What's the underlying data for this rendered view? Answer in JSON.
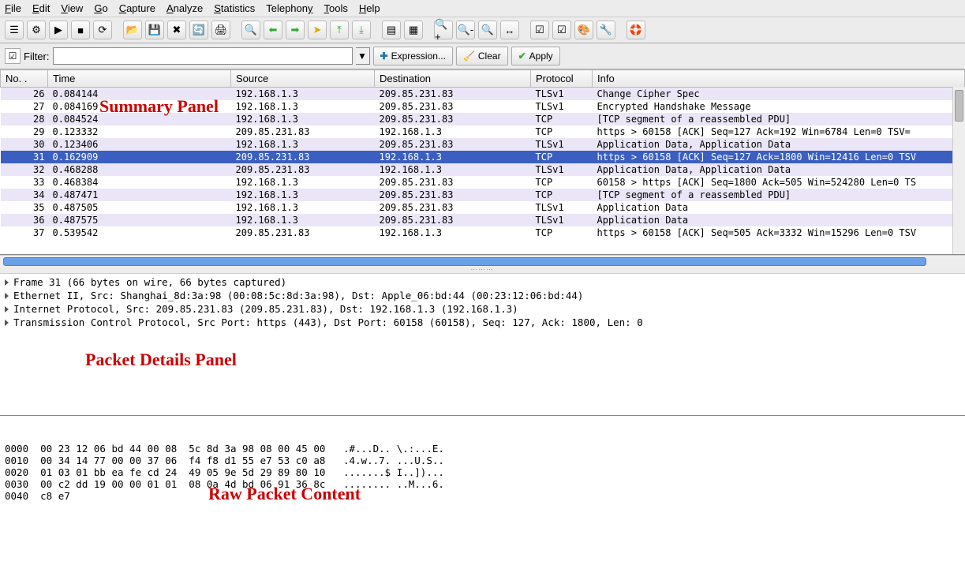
{
  "menu": [
    "File",
    "Edit",
    "View",
    "Go",
    "Capture",
    "Analyze",
    "Statistics",
    "Telephony",
    "Tools",
    "Help"
  ],
  "toolbar_icons": [
    "list-interfaces-icon",
    "capture-options-icon",
    "start-capture-icon",
    "stop-capture-icon",
    "restart-capture-icon",
    "open-icon",
    "save-icon",
    "close-icon",
    "reload-icon",
    "print-icon",
    "find-icon",
    "back-icon",
    "forward-icon",
    "jump-icon",
    "top-icon",
    "bottom-icon",
    "expand-icon",
    "collapse-icon",
    "zoom-in-icon",
    "zoom-out-icon",
    "zoom-reset-icon",
    "resize-cols-icon",
    "capture-filter-icon",
    "display-filter-icon",
    "colorize-icon",
    "prefs-icon",
    "help-icon"
  ],
  "filter": {
    "label": "Filter:",
    "value": "",
    "expression_btn": "Expression...",
    "clear_btn": "Clear",
    "apply_btn": "Apply"
  },
  "columns": {
    "no": "No. .",
    "time": "Time",
    "source": "Source",
    "destination": "Destination",
    "protocol": "Protocol",
    "info": "Info"
  },
  "packets": [
    {
      "no": "26",
      "time": "0.084144",
      "src": "192.168.1.3",
      "dst": "209.85.231.83",
      "proto": "TLSv1",
      "info": "Change Cipher Spec"
    },
    {
      "no": "27",
      "time": "0.084169",
      "src": "192.168.1.3",
      "dst": "209.85.231.83",
      "proto": "TLSv1",
      "info": "Encrypted Handshake Message"
    },
    {
      "no": "28",
      "time": "0.084524",
      "src": "192.168.1.3",
      "dst": "209.85.231.83",
      "proto": "TCP",
      "info": "[TCP segment of a reassembled PDU]"
    },
    {
      "no": "29",
      "time": "0.123332",
      "src": "209.85.231.83",
      "dst": "192.168.1.3",
      "proto": "TCP",
      "info": "https > 60158 [ACK] Seq=127 Ack=192 Win=6784 Len=0 TSV="
    },
    {
      "no": "30",
      "time": "0.123406",
      "src": "192.168.1.3",
      "dst": "209.85.231.83",
      "proto": "TLSv1",
      "info": "Application Data, Application Data"
    },
    {
      "no": "31",
      "time": "0.162909",
      "src": "209.85.231.83",
      "dst": "192.168.1.3",
      "proto": "TCP",
      "info": "https > 60158 [ACK] Seq=127 Ack=1800 Win=12416 Len=0 TSV"
    },
    {
      "no": "32",
      "time": "0.468288",
      "src": "209.85.231.83",
      "dst": "192.168.1.3",
      "proto": "TLSv1",
      "info": "Application Data, Application Data"
    },
    {
      "no": "33",
      "time": "0.468384",
      "src": "192.168.1.3",
      "dst": "209.85.231.83",
      "proto": "TCP",
      "info": "60158 > https [ACK] Seq=1800 Ack=505 Win=524280 Len=0 TS"
    },
    {
      "no": "34",
      "time": "0.487471",
      "src": "192.168.1.3",
      "dst": "209.85.231.83",
      "proto": "TCP",
      "info": "[TCP segment of a reassembled PDU]"
    },
    {
      "no": "35",
      "time": "0.487505",
      "src": "192.168.1.3",
      "dst": "209.85.231.83",
      "proto": "TLSv1",
      "info": "Application Data"
    },
    {
      "no": "36",
      "time": "0.487575",
      "src": "192.168.1.3",
      "dst": "209.85.231.83",
      "proto": "TLSv1",
      "info": "Application Data"
    },
    {
      "no": "37",
      "time": "0.539542",
      "src": "209.85.231.83",
      "dst": "192.168.1.3",
      "proto": "TCP",
      "info": "https > 60158 [ACK] Seq=505 Ack=3332 Win=15296 Len=0 TSV"
    }
  ],
  "selected_packet_no": "31",
  "details": [
    "Frame 31 (66 bytes on wire, 66 bytes captured)",
    "Ethernet II, Src: Shanghai_8d:3a:98 (00:08:5c:8d:3a:98), Dst: Apple_06:bd:44 (00:23:12:06:bd:44)",
    "Internet Protocol, Src: 209.85.231.83 (209.85.231.83), Dst: 192.168.1.3 (192.168.1.3)",
    "Transmission Control Protocol, Src Port: https (443), Dst Port: 60158 (60158), Seq: 127, Ack: 1800, Len: 0"
  ],
  "hex": [
    "0000  00 23 12 06 bd 44 00 08  5c 8d 3a 98 08 00 45 00   .#...D.. \\.:...E.",
    "0010  00 34 14 77 00 00 37 06  f4 f8 d1 55 e7 53 c0 a8   .4.w..7. ...U.S..",
    "0020  01 03 01 bb ea fe cd 24  49 05 9e 5d 29 89 80 10   .......$ I..])...",
    "0030  00 c2 dd 19 00 00 01 01  08 0a 4d bd 06 91 36 8c   ........ ..M...6.",
    "0040  c8 e7                                              .."
  ],
  "annotations": {
    "summary": "Summary Panel",
    "details": "Packet Details Panel",
    "raw": "Raw Packet Content"
  }
}
